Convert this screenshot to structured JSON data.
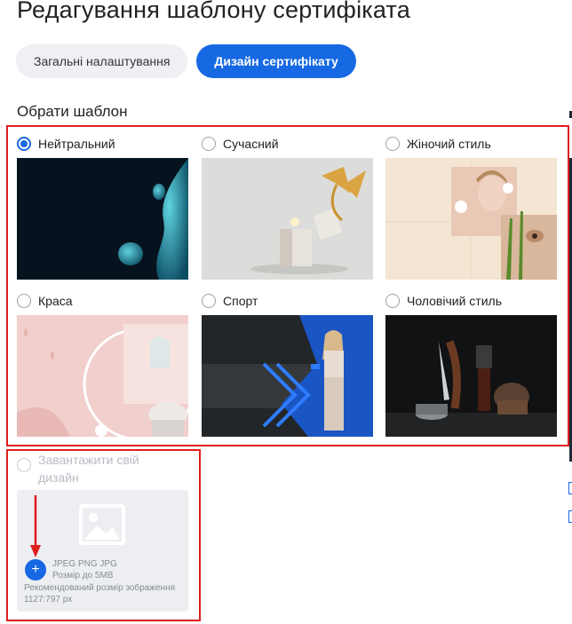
{
  "page": {
    "title": "Редагування шаблону сертифіката"
  },
  "tabs": [
    {
      "label": "Загальні налаштування",
      "active": false
    },
    {
      "label": "Дизайн сертифікату",
      "active": true
    }
  ],
  "section": {
    "title": "Обрати шаблон"
  },
  "templates": [
    {
      "label": "Нейтральний",
      "selected": true,
      "image": "dark-teal-abstract-shapes"
    },
    {
      "label": "Сучасний",
      "selected": false,
      "image": "gift-box-golden-ribbon"
    },
    {
      "label": "Жіночий стиль",
      "selected": false,
      "image": "skincare-woman-collage"
    },
    {
      "label": "Краса",
      "selected": false,
      "image": "pink-beauty-salon-interior"
    },
    {
      "label": "Спорт",
      "selected": false,
      "image": "fitness-woman-gym"
    },
    {
      "label": "Чоловічий стиль",
      "selected": false,
      "image": "barber-shaving-tools"
    }
  ],
  "upload": {
    "label": "Завантажити свій дизайн",
    "formats": "JPEG PNG JPG",
    "max_size": "Розмір до 5MB",
    "recommended": "Рекомендований розмір зображення 1127:797 px",
    "plus": "+"
  },
  "colors": {
    "accent": "#1668e3",
    "annotation": "#e01e1e",
    "tab_inactive": "#eef0f3"
  }
}
